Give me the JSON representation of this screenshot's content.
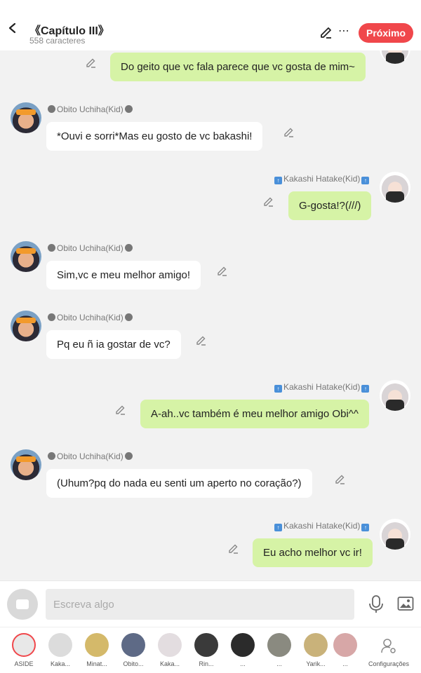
{
  "header": {
    "title": "《Capítulo III》",
    "subtitle": "558 caracteres",
    "next_label": "Próximo"
  },
  "messages": [
    {
      "side": "right",
      "author": "",
      "text": "Do geito que vc fala parece que vc gosta de mim~"
    },
    {
      "side": "left",
      "author": "Obito Uchiha(Kid)",
      "text": "*Ouvi e sorri*Mas eu gosto de vc bakashi!"
    },
    {
      "side": "right",
      "author": "Kakashi Hatake(Kid)",
      "text": "G-gosta!?(///)"
    },
    {
      "side": "left",
      "author": "Obito Uchiha(Kid)",
      "text": "Sim,vc e meu melhor amigo!"
    },
    {
      "side": "left",
      "author": "Obito Uchiha(Kid)",
      "text": "Pq eu ñ ia gostar de vc?"
    },
    {
      "side": "right",
      "author": "Kakashi Hatake(Kid)",
      "text": "A-ah..vc também é meu melhor amigo Obi^^"
    },
    {
      "side": "left",
      "author": "Obito Uchiha(Kid)",
      "text": "(Uhum?pq do nada eu senti um aperto no coração?)"
    },
    {
      "side": "right",
      "author": "Kakashi Hatake(Kid)",
      "text": "Eu acho melhor vc ir!"
    }
  ],
  "input": {
    "placeholder": "Escreva algo"
  },
  "characters": [
    {
      "label": "ASIDE"
    },
    {
      "label": "Kaka..."
    },
    {
      "label": "Minat..."
    },
    {
      "label": "Obito..."
    },
    {
      "label": "Kaka..."
    },
    {
      "label": "Rin..."
    },
    {
      "label": "..."
    },
    {
      "label": "..."
    },
    {
      "label": "Yarik..."
    },
    {
      "label": "..."
    }
  ],
  "config_label": "Configurações",
  "colors": {
    "accent": "#f0474b",
    "right_bubble": "#d6f3a6",
    "left_bubble": "#ffffff",
    "background": "#f2f2f2"
  }
}
